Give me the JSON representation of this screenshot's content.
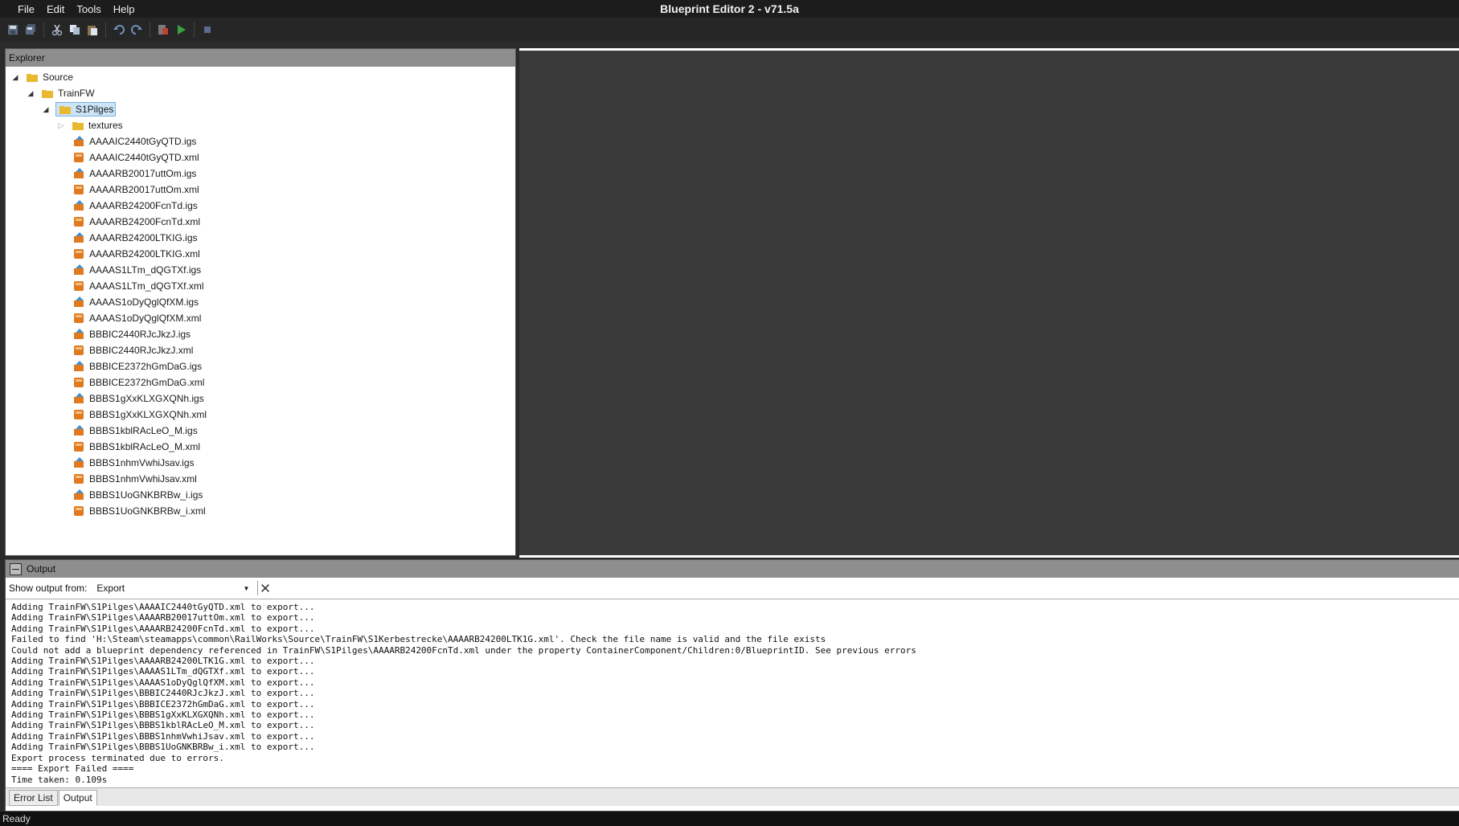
{
  "window": {
    "title": "Blueprint Editor 2 - v71.5a"
  },
  "menu": [
    "File",
    "Edit",
    "Tools",
    "Help"
  ],
  "toolbar": {
    "icons": [
      "save-icon",
      "save-all-icon",
      "cut-icon",
      "copy-icon",
      "paste-icon",
      "undo-icon",
      "redo-icon",
      "export-icon",
      "run-icon",
      "stop-icon"
    ]
  },
  "explorer": {
    "title": "Explorer",
    "root": "Source",
    "level1": "TrainFW",
    "level2": "S1Pilges",
    "folder": "textures",
    "files": [
      "AAAAIC2440tGyQTD.igs",
      "AAAAIC2440tGyQTD.xml",
      "AAAARB20017uttOm.igs",
      "AAAARB20017uttOm.xml",
      "AAAARB24200FcnTd.igs",
      "AAAARB24200FcnTd.xml",
      "AAAARB24200LTKIG.igs",
      "AAAARB24200LTKIG.xml",
      "AAAAS1LTm_dQGTXf.igs",
      "AAAAS1LTm_dQGTXf.xml",
      "AAAAS1oDyQglQfXM.igs",
      "AAAAS1oDyQglQfXM.xml",
      "BBBIC2440RJcJkzJ.igs",
      "BBBIC2440RJcJkzJ.xml",
      "BBBICE2372hGmDaG.igs",
      "BBBICE2372hGmDaG.xml",
      "BBBS1gXxKLXGXQNh.igs",
      "BBBS1gXxKLXGXQNh.xml",
      "BBBS1kblRAcLeO_M.igs",
      "BBBS1kblRAcLeO_M.xml",
      "BBBS1nhmVwhiJsav.igs",
      "BBBS1nhmVwhiJsav.xml",
      "BBBS1UoGNKBRBw_i.igs",
      "BBBS1UoGNKBRBw_i.xml"
    ]
  },
  "output": {
    "title": "Output",
    "show_label": "Show output from:",
    "source": "Export",
    "lines": [
      "Adding TrainFW\\S1Pilges\\AAAAIC2440tGyQTD.xml to export...",
      "Adding TrainFW\\S1Pilges\\AAAARB20017uttOm.xml to export...",
      "Adding TrainFW\\S1Pilges\\AAAARB24200FcnTd.xml to export...",
      "Failed to find 'H:\\Steam\\steamapps\\common\\RailWorks\\Source\\TrainFW\\S1Kerbestrecke\\AAAARB24200LTK1G.xml'. Check the file name is valid and the file exists",
      "Could not add a blueprint dependency referenced in TrainFW\\S1Pilges\\AAAARB24200FcnTd.xml under the property ContainerComponent/Children:0/BlueprintID. See previous errors",
      "Adding TrainFW\\S1Pilges\\AAAARB24200LTK1G.xml to export...",
      "Adding TrainFW\\S1Pilges\\AAAAS1LTm_dQGTXf.xml to export...",
      "Adding TrainFW\\S1Pilges\\AAAAS1oDyQglQfXM.xml to export...",
      "Adding TrainFW\\S1Pilges\\BBBIC2440RJcJkzJ.xml to export...",
      "Adding TrainFW\\S1Pilges\\BBBICE2372hGmDaG.xml to export...",
      "Adding TrainFW\\S1Pilges\\BBBS1gXxKLXGXQNh.xml to export...",
      "Adding TrainFW\\S1Pilges\\BBBS1kblRAcLeO_M.xml to export...",
      "Adding TrainFW\\S1Pilges\\BBBS1nhmVwhiJsav.xml to export...",
      "Adding TrainFW\\S1Pilges\\BBBS1UoGNKBRBw_i.xml to export...",
      "Export process terminated due to errors.",
      "==== Export Failed ====",
      "Time taken: 0.109s"
    ],
    "tabs": [
      "Error List",
      "Output"
    ]
  },
  "status": {
    "text": "Ready"
  },
  "colors": {
    "folder": "#e8b830",
    "xml_file": "#e07a20",
    "igs_file": "#4a90c8",
    "panel_header": "#8e8e8e"
  }
}
